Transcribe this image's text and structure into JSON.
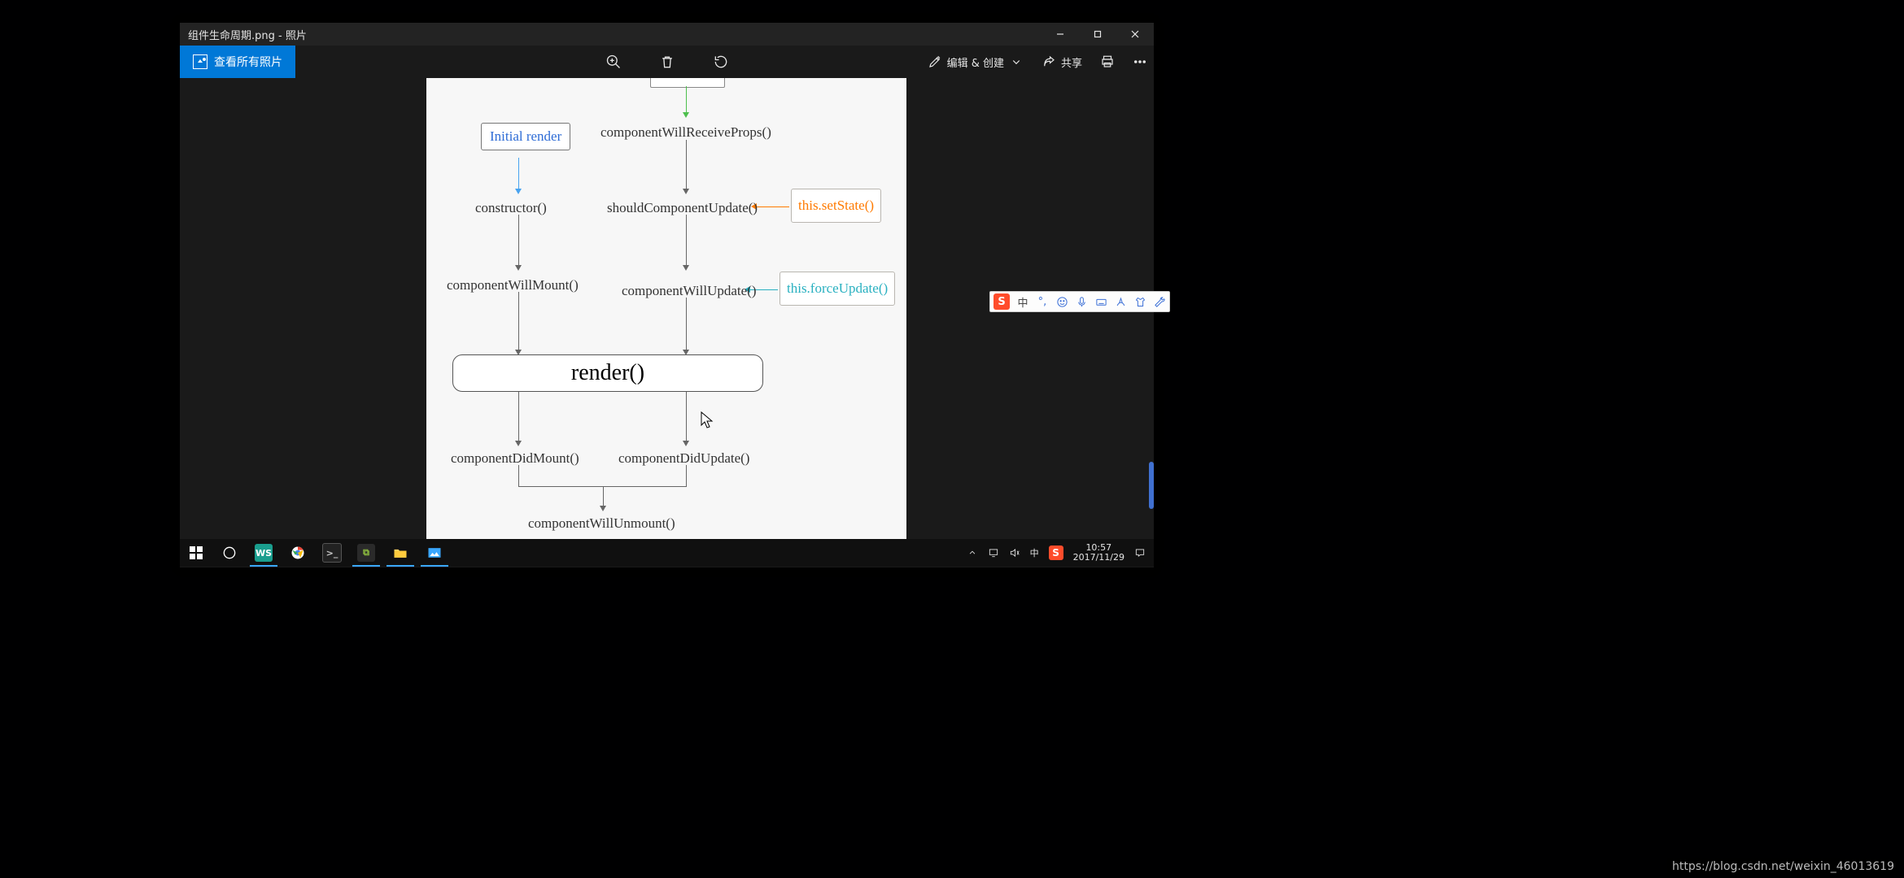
{
  "window": {
    "title": "组件生命周期.png - 照片",
    "see_all": "查看所有照片",
    "edit_create": "编辑 & 创建",
    "share": "共享"
  },
  "diagram": {
    "initial_render": "Initial render",
    "constructor": "constructor()",
    "componentWillMount": "componentWillMount()",
    "componentWillReceiveProps": "componentWillReceiveProps()",
    "shouldComponentUpdate": "shouldComponentUpdate()",
    "componentWillUpdate": "componentWillUpdate()",
    "setState": "this.setState()",
    "forceUpdate": "this.forceUpdate()",
    "render": "render()",
    "componentDidMount": "componentDidMount()",
    "componentDidUpdate": "componentDidUpdate()",
    "componentWillUnmount": "componentWillUnmount()"
  },
  "ime": {
    "lang": "中",
    "punct": "°,"
  },
  "systray": {
    "lang": "中",
    "time": "10:57",
    "date": "2017/11/29"
  },
  "footer_url": "https://blog.csdn.net/weixin_46013619"
}
